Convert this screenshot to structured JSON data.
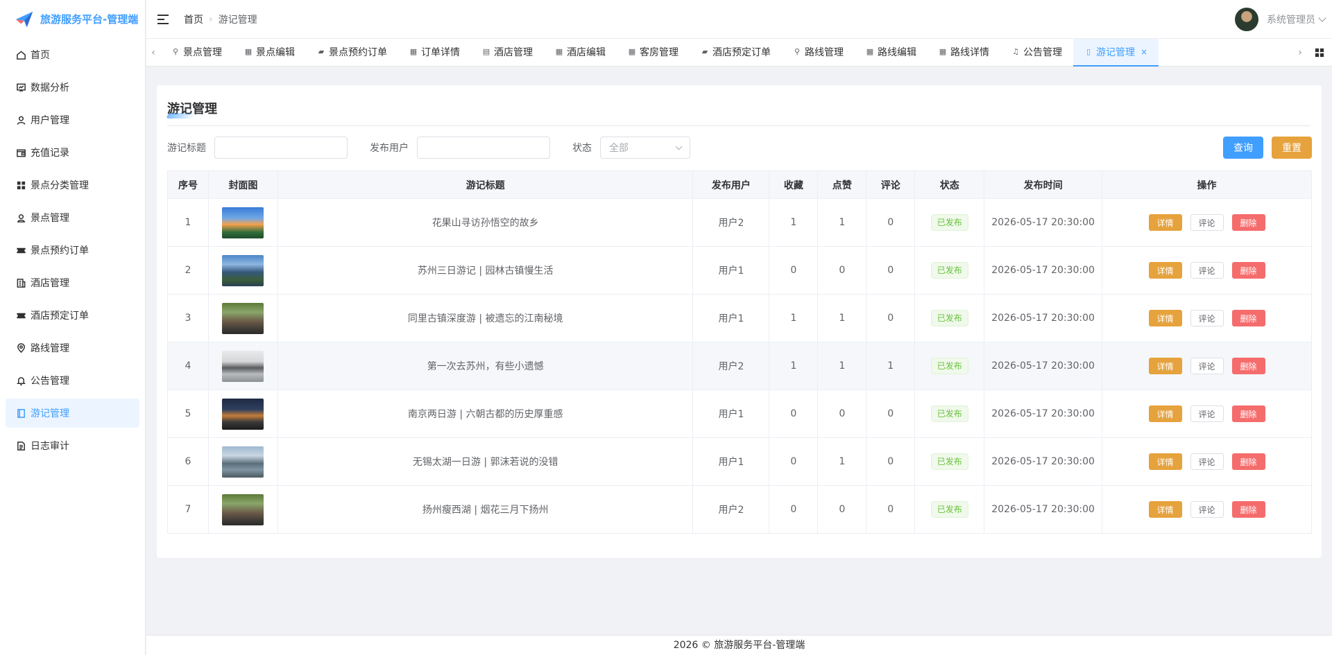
{
  "app": {
    "title": "旅游服务平台-管理端"
  },
  "colors": {
    "primary": "#409eff",
    "warning": "#e6a23c",
    "danger": "#f56c6c",
    "success": "#67c23a"
  },
  "sidebar": {
    "items": [
      {
        "label": "首页",
        "icon": "home-icon"
      },
      {
        "label": "数据分析",
        "icon": "chart-icon"
      },
      {
        "label": "用户管理",
        "icon": "user-icon"
      },
      {
        "label": "充值记录",
        "icon": "wallet-icon"
      },
      {
        "label": "景点分类管理",
        "icon": "grid-icon"
      },
      {
        "label": "景点管理",
        "icon": "location-icon"
      },
      {
        "label": "景点预约订单",
        "icon": "ticket-icon"
      },
      {
        "label": "酒店管理",
        "icon": "building-icon"
      },
      {
        "label": "酒店预定订单",
        "icon": "ticket-icon"
      },
      {
        "label": "路线管理",
        "icon": "map-pin-icon"
      },
      {
        "label": "公告管理",
        "icon": "bell-icon"
      },
      {
        "label": "游记管理",
        "icon": "notebook-icon",
        "active": true
      },
      {
        "label": "日志审计",
        "icon": "document-icon"
      }
    ]
  },
  "header": {
    "breadcrumb": {
      "home": "首页",
      "current": "游记管理"
    },
    "user": {
      "name": "系统管理员"
    }
  },
  "tabs": [
    {
      "label": "景点管理",
      "icon": "location-icon"
    },
    {
      "label": "景点编辑",
      "icon": "grid-icon"
    },
    {
      "label": "景点预约订单",
      "icon": "ticket-icon"
    },
    {
      "label": "订单详情",
      "icon": "grid-icon"
    },
    {
      "label": "酒店管理",
      "icon": "building-icon"
    },
    {
      "label": "酒店编辑",
      "icon": "grid-icon"
    },
    {
      "label": "客房管理",
      "icon": "grid-icon"
    },
    {
      "label": "酒店预定订单",
      "icon": "ticket-icon"
    },
    {
      "label": "路线管理",
      "icon": "map-pin-icon"
    },
    {
      "label": "路线编辑",
      "icon": "grid-icon"
    },
    {
      "label": "路线详情",
      "icon": "grid-icon"
    },
    {
      "label": "公告管理",
      "icon": "bell-icon"
    },
    {
      "label": "游记管理",
      "icon": "notebook-icon",
      "active": true,
      "close": "×"
    }
  ],
  "page": {
    "title": "游记管理",
    "filter": {
      "title_label": "游记标题",
      "title_value": "",
      "user_label": "发布用户",
      "user_value": "",
      "status_label": "状态",
      "status_value": "全部",
      "query_label": "查询",
      "reset_label": "重置"
    },
    "table": {
      "columns": [
        "序号",
        "封面图",
        "游记标题",
        "发布用户",
        "收藏",
        "点赞",
        "评论",
        "状态",
        "发布时间",
        "操作"
      ],
      "actions": {
        "detail": "详情",
        "comment": "评论",
        "delete": "删除"
      },
      "rows": [
        {
          "no": "1",
          "title": "花果山寻访孙悟空的故乡",
          "user": "用户2",
          "fav": "1",
          "like": "1",
          "comments": "0",
          "status": "已发布",
          "time": "2026-05-17 20:30:00"
        },
        {
          "no": "2",
          "title": "苏州三日游记 | 园林古镇慢生活",
          "user": "用户1",
          "fav": "0",
          "like": "0",
          "comments": "0",
          "status": "已发布",
          "time": "2026-05-17 20:30:00"
        },
        {
          "no": "3",
          "title": "同里古镇深度游 | 被遗忘的江南秘境",
          "user": "用户1",
          "fav": "1",
          "like": "1",
          "comments": "0",
          "status": "已发布",
          "time": "2026-05-17 20:30:00"
        },
        {
          "no": "4",
          "title": "第一次去苏州，有些小遗憾",
          "user": "用户2",
          "fav": "1",
          "like": "1",
          "comments": "1",
          "status": "已发布",
          "time": "2026-05-17 20:30:00"
        },
        {
          "no": "5",
          "title": "南京两日游 | 六朝古都的历史厚重感",
          "user": "用户1",
          "fav": "0",
          "like": "0",
          "comments": "0",
          "status": "已发布",
          "time": "2026-05-17 20:30:00"
        },
        {
          "no": "6",
          "title": "无锡太湖一日游 | 郭沫若说的没错",
          "user": "用户1",
          "fav": "0",
          "like": "1",
          "comments": "0",
          "status": "已发布",
          "time": "2026-05-17 20:30:00"
        },
        {
          "no": "7",
          "title": "扬州瘦西湖 | 烟花三月下扬州",
          "user": "用户2",
          "fav": "0",
          "like": "0",
          "comments": "0",
          "status": "已发布",
          "time": "2026-05-17 20:30:00"
        }
      ]
    }
  },
  "footer": {
    "text": "2026 © 旅游服务平台-管理端"
  }
}
